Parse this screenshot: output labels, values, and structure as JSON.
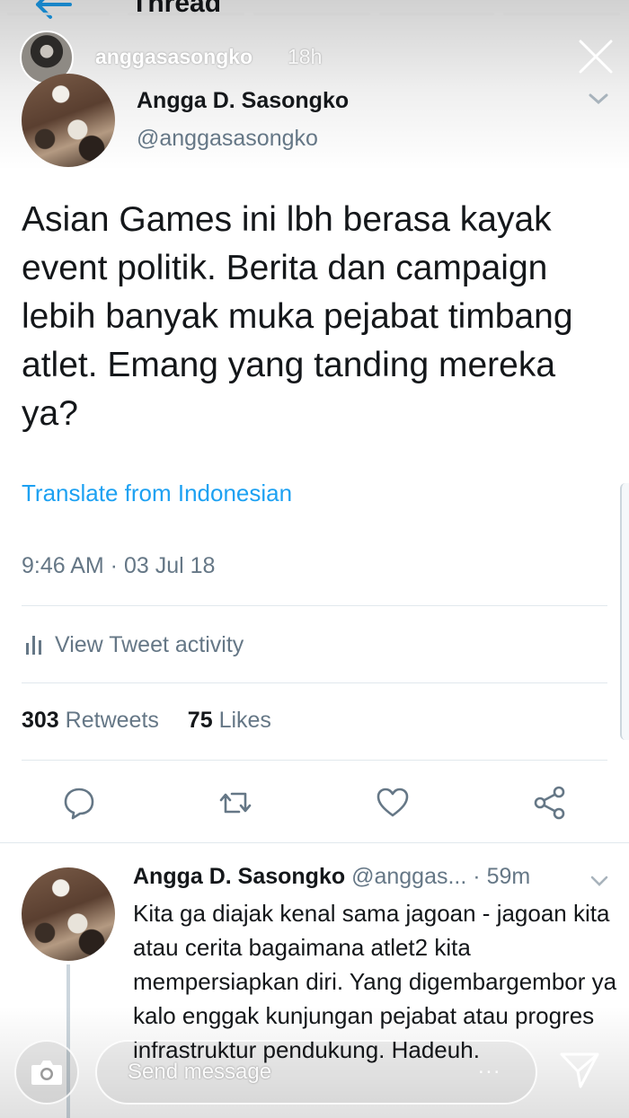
{
  "app_bar": {
    "title": "Thread",
    "back_icon": "back-arrow-icon"
  },
  "story": {
    "username": "anggasasongko",
    "age": "18h",
    "close_icon": "close-icon",
    "progress_segments": 5,
    "message_placeholder": "Send message",
    "more_label": "...",
    "camera_icon": "camera-icon",
    "send_icon": "send-icon"
  },
  "main_tweet": {
    "name": "Angga D. Sasongko",
    "handle": "@anggasasongko",
    "text": "Asian Games ini lbh berasa kayak event politik. Berita dan campaign lebih banyak muka pejabat timbang atlet. Emang yang tanding mereka ya?",
    "translate_label": "Translate from Indonesian",
    "timestamp": "9:46 AM · 03 Jul 18",
    "activity_label": "View Tweet activity",
    "retweets_count": "303",
    "retweets_label": "Retweets",
    "likes_count": "75",
    "likes_label": "Likes",
    "actions": [
      "reply-icon",
      "retweet-icon",
      "like-icon",
      "share-icon"
    ]
  },
  "reply_tweet": {
    "name": "Angga D. Sasongko",
    "handle": "@anggas...",
    "time": "· 59m",
    "text": "Kita ga diajak kenal sama jagoan - jagoan kita atau cerita bagaimana atlet2 kita mempersiapkan diri. Yang digembargembor ya kalo enggak kunjungan pejabat atau progres infrastruktur pendukung. Hadeuh."
  },
  "colors": {
    "link": "#1da1f2",
    "secondary_text": "#657786",
    "primary_text": "#14171a",
    "divider": "#e1e8ed"
  }
}
